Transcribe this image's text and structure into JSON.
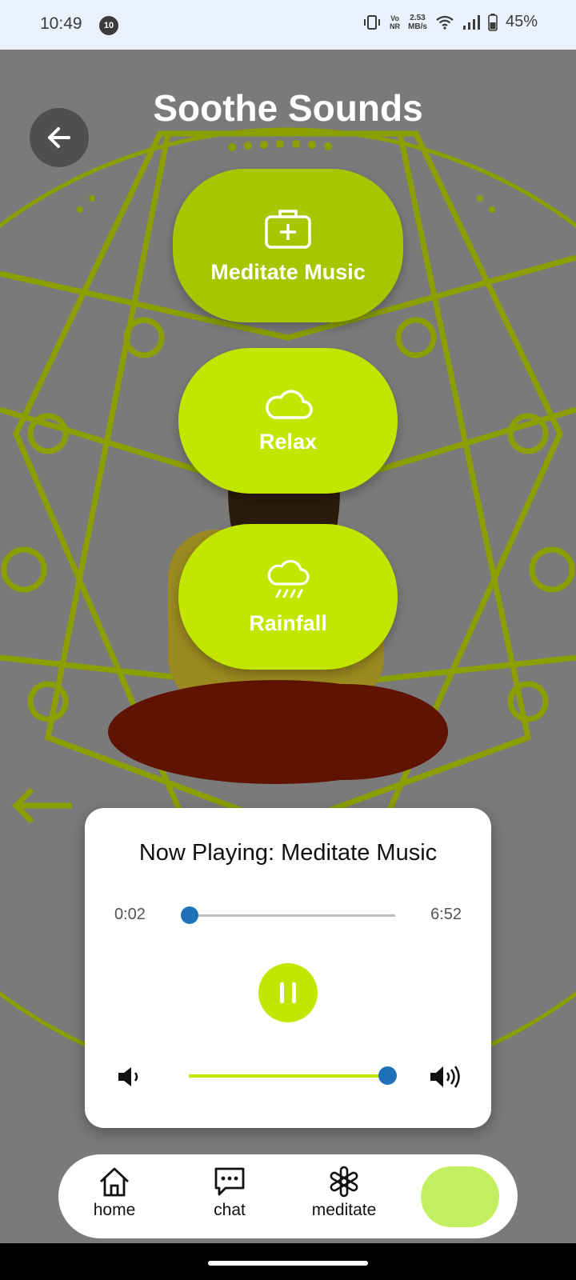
{
  "status_bar": {
    "time": "10:49",
    "notification_badge": "10",
    "volte_top": "Vo",
    "volte_bottom": "NR",
    "speed_value": "2.53",
    "speed_unit": "MB/s",
    "battery": "45%"
  },
  "header": {
    "title": "Soothe Sounds"
  },
  "sounds": [
    {
      "label": "Meditate Music",
      "icon": "first-aid-kit-icon"
    },
    {
      "label": "Relax",
      "icon": "cloud-icon"
    },
    {
      "label": "Rainfall",
      "icon": "rain-cloud-icon"
    }
  ],
  "player": {
    "now_playing": "Now Playing: Meditate Music",
    "current_time": "0:02",
    "total_time": "6:52",
    "progress_fraction": 0.005,
    "volume_fraction": 0.96,
    "accent_color": "#c2e600",
    "thumb_color": "#1e73b8"
  },
  "nav": {
    "items": [
      {
        "label": "home",
        "icon": "home-icon"
      },
      {
        "label": "chat",
        "icon": "chat-icon"
      },
      {
        "label": "meditate",
        "icon": "asterisk-icon"
      }
    ]
  }
}
